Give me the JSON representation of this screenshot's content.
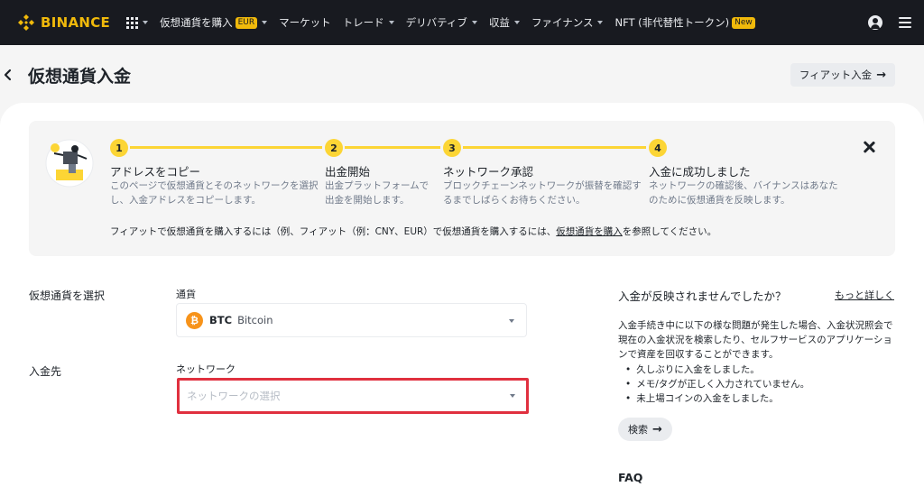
{
  "nav": {
    "brand": "BINANCE",
    "items": [
      {
        "label": "仮想通貨を購入",
        "badge": "EUR",
        "dropdown": true
      },
      {
        "label": "マーケット",
        "badge": "",
        "dropdown": false
      },
      {
        "label": "トレード",
        "badge": "",
        "dropdown": true
      },
      {
        "label": "デリバティブ",
        "badge": "",
        "dropdown": true
      },
      {
        "label": "収益",
        "badge": "",
        "dropdown": true
      },
      {
        "label": "ファイナンス",
        "badge": "",
        "dropdown": true
      },
      {
        "label": "NFT (非代替性トークン)",
        "badge": "New",
        "dropdown": false
      }
    ],
    "icons": [
      "grid-icon",
      "user-icon",
      "menu-icon"
    ]
  },
  "header": {
    "title": "仮想通貨入金",
    "fiat_button": "フィアット入金",
    "fiat_arrow": "→"
  },
  "steps": [
    {
      "number": "1",
      "title": "アドレスをコピー",
      "desc": "このページで仮想通貨とそのネットワークを選択し、入金アドレスをコピーします。"
    },
    {
      "number": "2",
      "title": "出金開始",
      "desc": "出金プラットフォームで出金を開始します。"
    },
    {
      "number": "3",
      "title": "ネットワーク承認",
      "desc": "ブロックチェーンネットワークが振替を確認するまでしばらくお待ちください。"
    },
    {
      "number": "4",
      "title": "入金に成功しました",
      "desc": "ネットワークの確認後、バイナンスはあなたのために仮想通貨を反映します。"
    }
  ],
  "steps_note": {
    "prefix": "フィアットで仮想通貨を購入するには（例、フィアット（例：CNY、EUR）で仮想通貨を購入するには、",
    "link": "仮想通貨を購入",
    "suffix": "を参照してください。"
  },
  "form": {
    "crypto_label": "仮想通貨を選択",
    "currency_field_label": "通貨",
    "coin_symbol": "BTC",
    "coin_name": "Bitcoin",
    "coin_glyph": "₿",
    "deposit_label": "入金先",
    "network_field_label": "ネットワーク",
    "network_placeholder": "ネットワークの選択"
  },
  "help": {
    "title": "入金が反映されませんでしたか？",
    "more_link": "もっと詳しく",
    "description": "入金手続き中に以下の様な問題が発生した場合、入金状況照会で現在の入金状況を検索したり、セルフサービスのアプリケーションで資産を回収することができます。",
    "items": [
      "久しぶりに入金をしました。",
      "メモ/タグが正しく入力されていません。",
      "未上場コインの入金をしました。"
    ],
    "search_button": "検索",
    "search_arrow": "→",
    "faq_title": "FAQ"
  },
  "colors": {
    "brand_yellow": "#f0b90b",
    "step_yellow": "#fcd535",
    "nav_bg": "#181a20",
    "highlight_red": "#e0303f",
    "btc_orange": "#f7931a"
  }
}
